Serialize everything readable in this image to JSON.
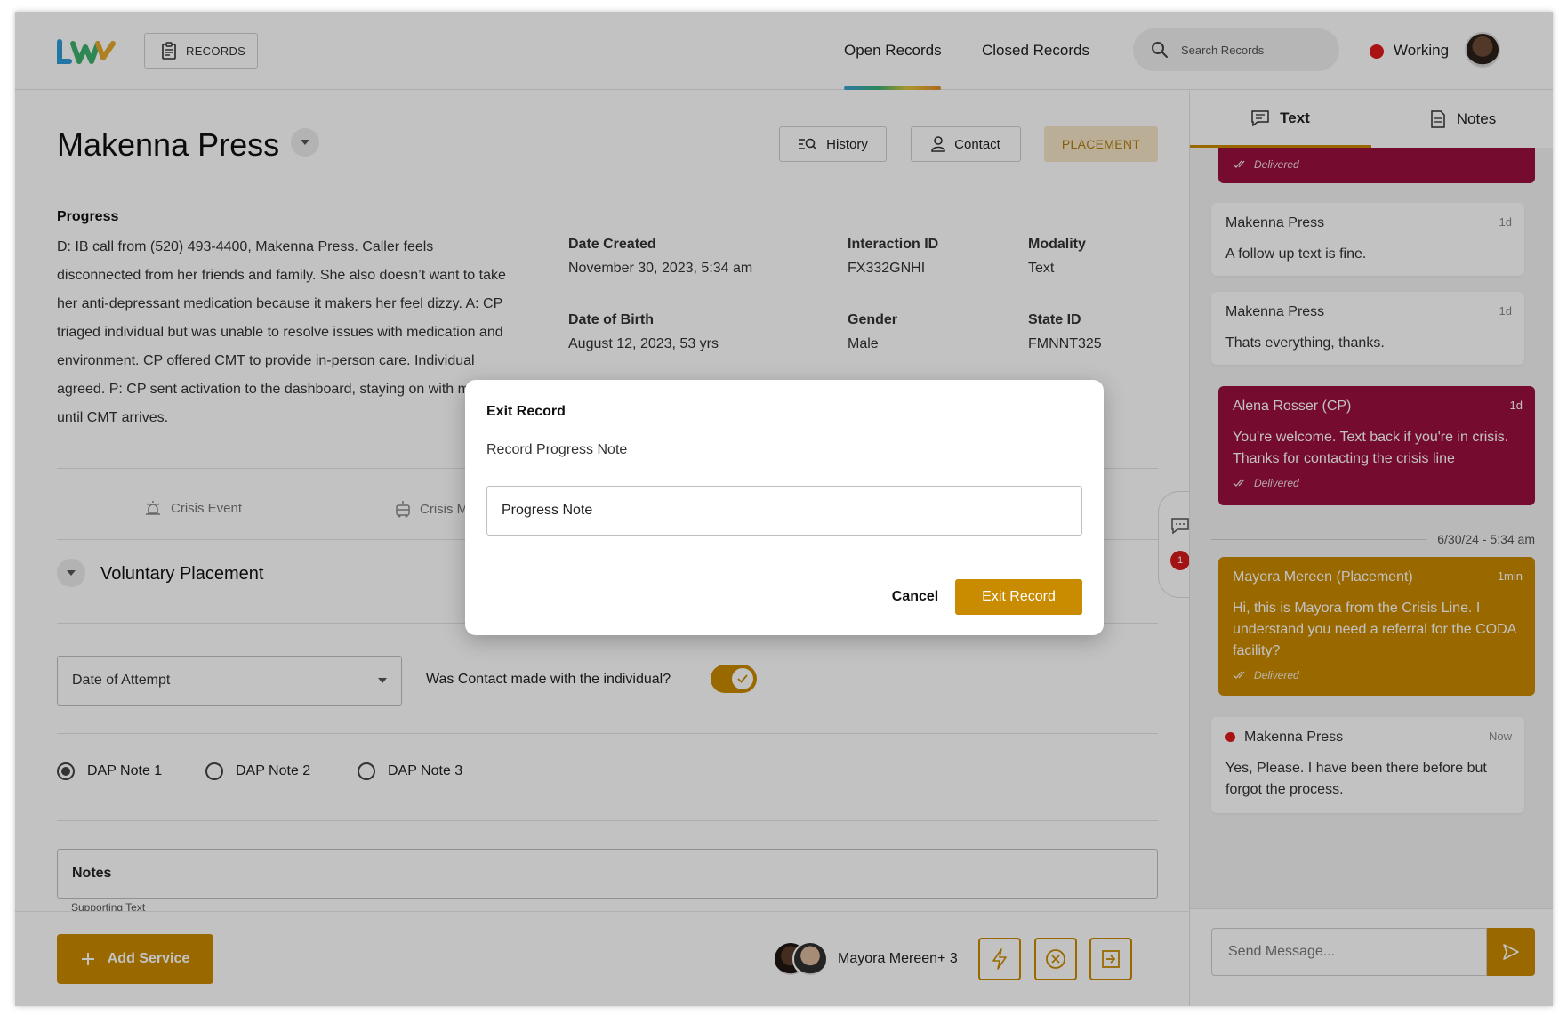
{
  "colors": {
    "accent": "#c98b00",
    "cp_bubble": "#9a0f3d",
    "status_red": "#e01919",
    "placement_bg": "#f5e6c5"
  },
  "header": {
    "records_label": "RECORDS",
    "tabs": {
      "open": "Open Records",
      "closed": "Closed Records"
    },
    "search_placeholder": "Search Records",
    "status": "Working"
  },
  "record": {
    "name": "Makenna Press",
    "buttons": {
      "history": "History",
      "contact": "Contact",
      "placement": "PLACEMENT"
    },
    "progress_label": "Progress",
    "progress_text": "D: IB call from (520) 493-4400, Makenna Press. Caller feels disconnected from her friends and family. She also doesn’t want to take her anti-depressant medication because it makers her feel dizzy. A: CP triaged individual but was unable to resolve issues with medication and environment. CP offered CMT to provide in-person care. Individual agreed. P:  CP sent activation to the dashboard, staying on with member until CMT arrives.",
    "fields": {
      "date_created_label": "Date Created",
      "date_created": "November 30, 2023, 5:34 am",
      "interaction_label": "Interaction ID",
      "interaction": "FX332GNHI",
      "modality_label": "Modality",
      "modality": "Text",
      "dob_label": "Date of Birth",
      "dob": "August 12, 2023, 53 yrs",
      "gender_label": "Gender",
      "gender": "Male",
      "state_label": "State ID",
      "state": "FMNNT325"
    },
    "event_tabs": {
      "crisis_event": "Crisis Event",
      "crisis_m": "Crisis M"
    },
    "section_title": "Voluntary Placement",
    "date_of_attempt": "Date of Attempt",
    "contact_question": "Was Contact made with the individual?",
    "contact_made": true,
    "dap_notes": [
      "DAP Note 1",
      "DAP Note 2",
      "DAP Note 3"
    ],
    "dap_selected": 0,
    "notes_label": "Notes",
    "supporting_text": "Supporting Text",
    "dock_badge": "1"
  },
  "footer": {
    "add_service": "Add Service",
    "team": "Mayora Mereen+ 3"
  },
  "panel": {
    "tabs": {
      "text": "Text",
      "notes": "Notes"
    },
    "messages": [
      {
        "sender": "",
        "time": "",
        "text": "",
        "delivered": "Delivered"
      },
      {
        "sender": "Makenna Press",
        "time": "1d",
        "text": "A follow up text is fine."
      },
      {
        "sender": "Makenna Press",
        "time": "1d",
        "text": "Thats everything, thanks."
      },
      {
        "sender": "Alena Rosser (CP)",
        "time": "1d",
        "text": "You're welcome. Text back if you're in crisis. Thanks for contacting the crisis line",
        "delivered": "Delivered"
      },
      {
        "sender": "Mayora Mereen (Placement)",
        "time": "1min",
        "text": "Hi, this is Mayora from the Crisis Line. I understand you need a referral for the CODA facility?",
        "delivered": "Delivered"
      },
      {
        "sender": "Makenna Press",
        "time": "Now",
        "text": "Yes, Please. I have been there before but forgot the process."
      }
    ],
    "date_separator": "6/30/24 - 5:34 am",
    "send_placeholder": "Send Message..."
  },
  "modal": {
    "title": "Exit Record",
    "subtitle": "Record Progress Note",
    "input_value": "Progress Note",
    "cancel": "Cancel",
    "confirm": "Exit Record"
  }
}
